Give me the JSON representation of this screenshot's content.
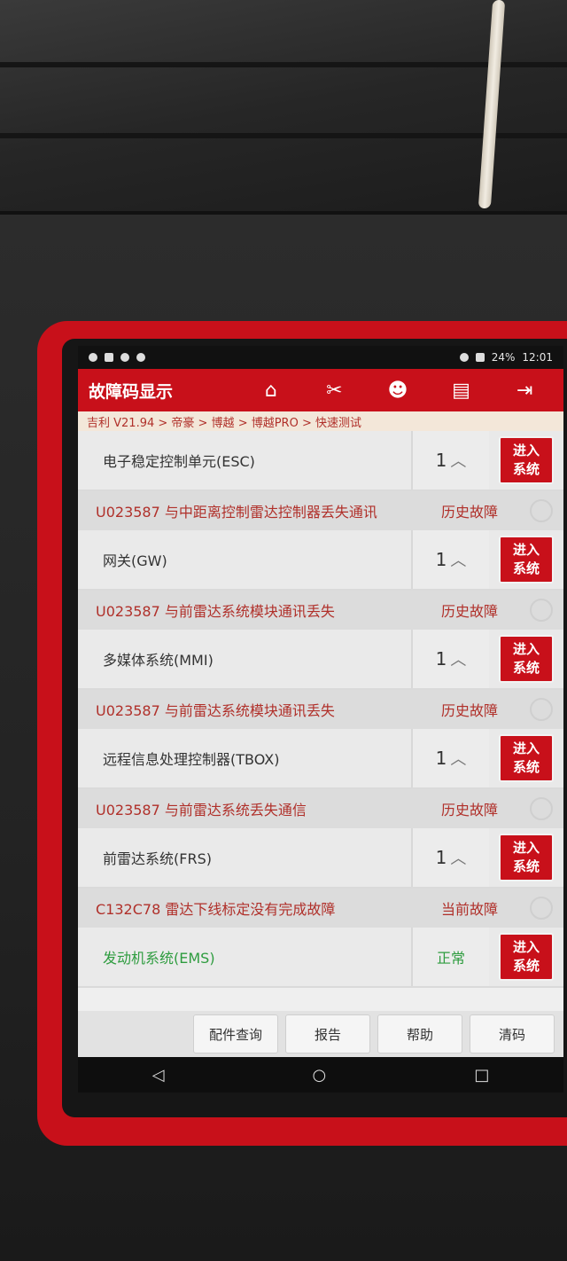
{
  "statusbar": {
    "battery": "24%",
    "time": "12:01"
  },
  "appbar": {
    "title": "故障码显示",
    "icons": [
      "home-icon",
      "diagnostic-tool-icon",
      "user-icon",
      "print-icon",
      "exit-icon"
    ]
  },
  "breadcrumb": "吉利 V21.94 > 帝豪 > 博越 > 博越PRO > 快速测试",
  "enter_label_line1": "进入",
  "enter_label_line2": "系统",
  "systems": [
    {
      "name": "电子稳定控制单元(ESC)",
      "count": "1",
      "fault_code": "U023587 与中距离控制雷达控制器丢失通讯",
      "fault_status": "历史故障"
    },
    {
      "name": "网关(GW)",
      "count": "1",
      "fault_code": "U023587 与前雷达系统模块通讯丢失",
      "fault_status": "历史故障"
    },
    {
      "name": "多媒体系统(MMI)",
      "count": "1",
      "fault_code": "U023587 与前雷达系统模块通讯丢失",
      "fault_status": "历史故障"
    },
    {
      "name": "远程信息处理控制器(TBOX)",
      "count": "1",
      "fault_code": "U023587 与前雷达系统丢失通信",
      "fault_status": "历史故障"
    },
    {
      "name": "前雷达系统(FRS)",
      "count": "1",
      "fault_code": "C132C78 雷达下线标定没有完成故障",
      "fault_status": "当前故障"
    },
    {
      "name": "发动机系统(EMS)",
      "count": "正常"
    }
  ],
  "toolbar": {
    "parts_query": "配件查询",
    "report": "报告",
    "help": "帮助",
    "clear": "清码"
  },
  "colors": {
    "brand_red": "#c8101a",
    "fault_text": "#b0302a",
    "ok_green": "#2e9c3f"
  }
}
